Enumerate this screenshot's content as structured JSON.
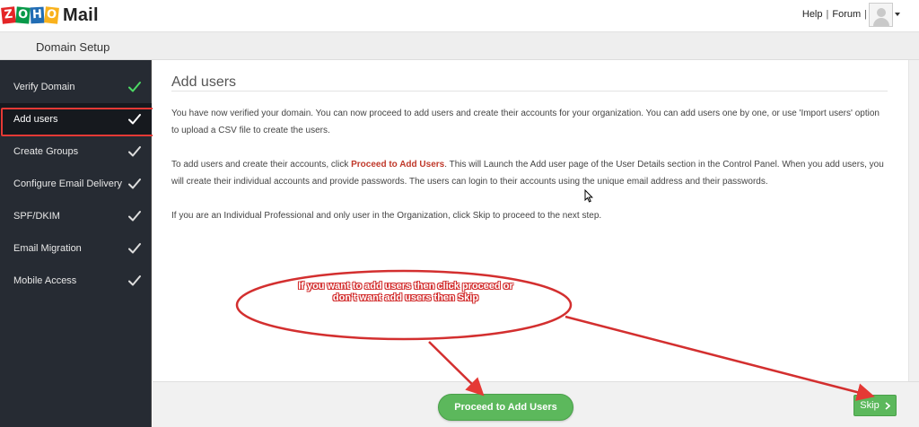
{
  "app": {
    "logo_letters": [
      "Z",
      "O",
      "H",
      "O"
    ],
    "logo_word": "Mail"
  },
  "header": {
    "links": [
      "Help",
      "Forum"
    ],
    "separator": "|"
  },
  "subheader": {
    "title": "Domain Setup"
  },
  "sidebar": {
    "items": [
      {
        "label": "Verify Domain",
        "done": true,
        "check_color": "#4cd964"
      },
      {
        "label": "Add users",
        "active": true,
        "check_color": "#ffffff"
      },
      {
        "label": "Create Groups",
        "check_color": "#dddddd"
      },
      {
        "label": "Configure Email Delivery",
        "check_color": "#dddddd"
      },
      {
        "label": "SPF/DKIM",
        "check_color": "#dddddd"
      },
      {
        "label": "Email Migration",
        "check_color": "#dddddd"
      },
      {
        "label": "Mobile Access",
        "check_color": "#dddddd"
      }
    ]
  },
  "main": {
    "heading": "Add users",
    "p1": "You have now verified your domain. You can now proceed to add users and create their accounts for your organization. You can add users one by one, or use 'Import users' option to upload a CSV file to create the users.",
    "p2_before": "To add users and create their accounts, click ",
    "p2_highlight": "Proceed to Add Users",
    "p2_after": ". This will Launch the Add user page of the User Details section in the Control Panel. When you add users, you will create their individual accounts and provide passwords. The users can login to their accounts using the unique email address and their passwords.",
    "p3": "If you are an Individual Professional and only user in the Organization, click Skip to proceed to the next step."
  },
  "footer": {
    "proceed_label": "Proceed to Add Users",
    "skip_label": "Skip",
    "skip_icon": "chevron-right-icon"
  },
  "annotation": {
    "line1": "If you want to add users then click proceed or",
    "line2": "don't want add users then Skip"
  },
  "colors": {
    "sidebar_bg": "#262b33",
    "accent_green": "#5cb85c",
    "annotation_red": "#d32f2f"
  }
}
